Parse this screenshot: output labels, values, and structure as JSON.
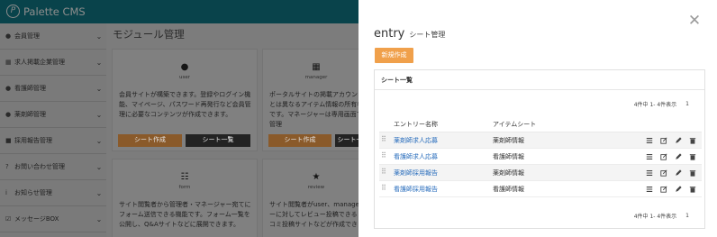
{
  "app": {
    "name": "Palette CMS"
  },
  "sidebar": {
    "items": [
      {
        "icon": "users-icon",
        "glyph": "●",
        "label": "会員管理"
      },
      {
        "icon": "building-icon",
        "glyph": "▦",
        "label": "求人掲載企業管理"
      },
      {
        "icon": "person-icon",
        "glyph": "●",
        "label": "看護師管理"
      },
      {
        "icon": "person-icon",
        "glyph": "●",
        "label": "薬剤師管理"
      },
      {
        "icon": "briefcase-icon",
        "glyph": "■",
        "label": "採用報告管理"
      },
      {
        "icon": "question-circle-icon",
        "glyph": "?",
        "label": "お問い合わせ管理"
      },
      {
        "icon": "info-circle-icon",
        "glyph": "i",
        "label": "お知らせ管理"
      },
      {
        "icon": "checkbox-icon",
        "glyph": "☑",
        "label": "メッセージBOX"
      }
    ]
  },
  "main": {
    "title": "モジュール管理",
    "cards": [
      {
        "icon": "user-icon",
        "glyph": "●",
        "label": "user",
        "desc": "会員サイトが構築できます。登録やログイン機\n能、マイページ、パスワード再発行など会員管\n理に必要なコンテンツが作成できます。",
        "btn_primary": "シート作成",
        "btn_secondary": "シート一覧"
      },
      {
        "icon": "building-icon",
        "glyph": "▦",
        "label": "manager",
        "desc": "ポータルサイトの掲載アカウント\nとは異なるアイテム情報の所有者\nです。マネージャーは専用画面で管理",
        "btn_primary": "シート作成",
        "btn_secondary": "シート一覧"
      },
      {
        "icon": "form-icon",
        "glyph": "☷",
        "label": "form",
        "desc": "サイト閲覧者から管理者・マネージャー宛てに\nフォーム送信できる機能です。フォーム一覧を\n公開し、Q&Aサイトなどに展開できます。"
      },
      {
        "icon": "star-icon",
        "glyph": "★",
        "label": "review",
        "desc": "サイト閲覧者がuser、manager\nーに対してレビュー投稿できる\nコミ投稿サイトなどが作成でき"
      }
    ]
  },
  "drawer": {
    "title": "entry",
    "subtitle": "シート管理",
    "new_button": "新規作成",
    "panel_title": "シート一覧",
    "pager": {
      "summary": "4件中 1- 4件表示",
      "page": "1"
    },
    "columns": {
      "name": "エントリー名称",
      "item": "アイテムシート"
    },
    "rows": [
      {
        "name": "薬剤師求人応募",
        "item": "薬剤師情報"
      },
      {
        "name": "看護師求人応募",
        "item": "看護師情報"
      },
      {
        "name": "薬剤師採用報告",
        "item": "薬剤師情報"
      },
      {
        "name": "看護師採用報告",
        "item": "看護師情報"
      }
    ],
    "row_actions": [
      "list-icon",
      "edit-square-icon",
      "pencil-icon",
      "trash-icon"
    ],
    "colors": {
      "accent": "#f0a04b",
      "link": "#2a6ebd",
      "overlay": "#7b7b7b"
    }
  }
}
